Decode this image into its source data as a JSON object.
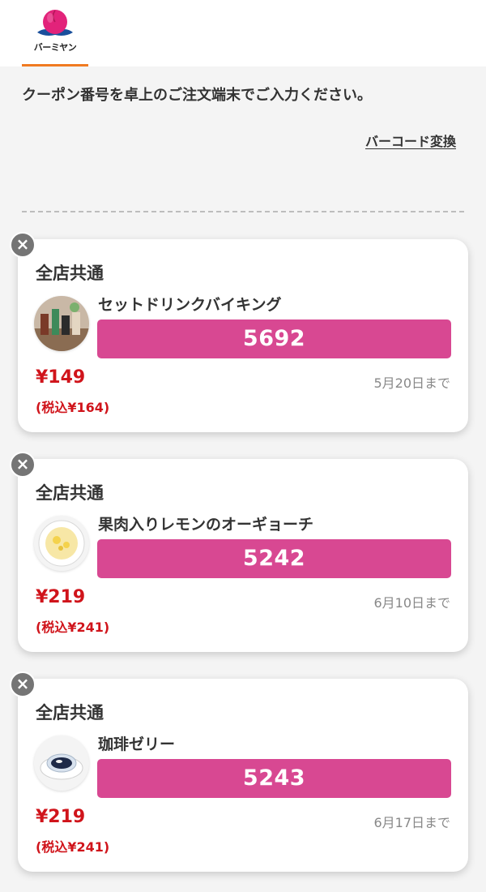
{
  "header": {
    "logo_text": "バーミヤン",
    "brand_color": "#f07a21",
    "logo_icon": "peach-logo-icon"
  },
  "instruction": "クーポン番号を卓上のご注文端末でご入力ください。",
  "barcode_link": "バーコード変換",
  "accent_color": "#d84892",
  "price_color": "#d0141b",
  "close_icon": "×",
  "coupons": [
    {
      "scope": "全店共通",
      "name": "セットドリンクバイキング",
      "code": "5692",
      "price": "¥149",
      "price_tax": "(税込¥164)",
      "deadline": "5月20日まで",
      "thumb_icon": "drink-bar-photo"
    },
    {
      "scope": "全店共通",
      "name": "果肉入りレモンのオーギョーチ",
      "code": "5242",
      "price": "¥219",
      "price_tax": "(税込¥241)",
      "deadline": "6月10日まで",
      "thumb_icon": "lemon-dessert-photo"
    },
    {
      "scope": "全店共通",
      "name": "珈琲ゼリー",
      "code": "5243",
      "price": "¥219",
      "price_tax": "(税込¥241)",
      "deadline": "6月17日まで",
      "thumb_icon": "coffee-jelly-photo"
    }
  ]
}
